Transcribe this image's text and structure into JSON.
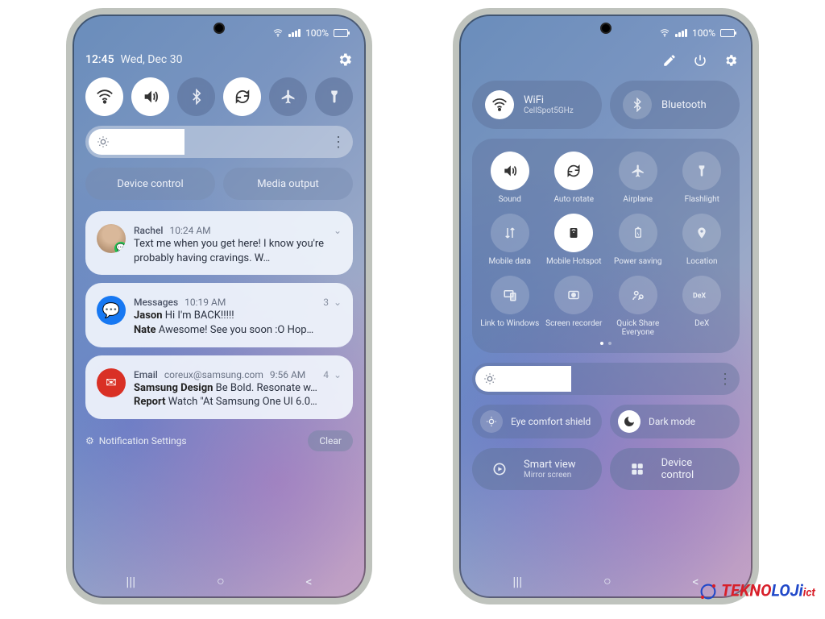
{
  "status": {
    "battery_pct": "100%"
  },
  "panelA": {
    "time": "12:45",
    "date": "Wed, Dec 30",
    "qs": {
      "wifi": "on",
      "sound": "on",
      "bluetooth": "off",
      "rotate": "on",
      "airplane": "off",
      "flashlight": "off"
    },
    "brightness_pct": 40,
    "device_control": "Device control",
    "media_output": "Media output",
    "notifications": [
      {
        "app": "Rachel",
        "time": "10:24 AM",
        "count": "",
        "avatar_color": "#9d7a5a",
        "badge_color": "#1fbf4f",
        "lines": [
          {
            "sender": "",
            "text": "Text me when you get here! I know you're probably having cravings. W…"
          }
        ]
      },
      {
        "app": "Messages",
        "time": "10:19 AM",
        "count": "3",
        "avatar_color": "#1778f2",
        "badge_color": "",
        "lines": [
          {
            "sender": "Jason",
            "text": "Hi I'm BACK!!!!!"
          },
          {
            "sender": "Nate",
            "text": "Awesome! See you soon :O Hop…"
          }
        ]
      },
      {
        "app": "Email",
        "sub": "coreux@samsung.com",
        "time": "9:56 AM",
        "count": "4",
        "avatar_color": "#d93025",
        "badge_color": "",
        "lines": [
          {
            "sender": "Samsung Design",
            "text": "Be Bold. Resonate w…"
          },
          {
            "sender": "Report",
            "text": "Watch \"At Samsung One UI 6.0…"
          }
        ]
      }
    ],
    "settings_label": "Notification Settings",
    "clear_label": "Clear"
  },
  "panelB": {
    "wide": {
      "wifi": {
        "title": "WiFi",
        "sub": "CellSpot5GHz",
        "on": true
      },
      "bt": {
        "title": "Bluetooth",
        "sub": "",
        "on": false
      }
    },
    "grid": [
      {
        "key": "sound",
        "label": "Sound",
        "on": true
      },
      {
        "key": "autorotate",
        "label": "Auto rotate",
        "on": true
      },
      {
        "key": "airplane",
        "label": "Airplane",
        "on": false
      },
      {
        "key": "flashlight",
        "label": "Flashlight",
        "on": false
      },
      {
        "key": "mobiledata",
        "label": "Mobile data",
        "on": false
      },
      {
        "key": "hotspot",
        "label": "Mobile Hotspot",
        "on": true
      },
      {
        "key": "powersave",
        "label": "Power saving",
        "on": false
      },
      {
        "key": "location",
        "label": "Location",
        "on": false
      },
      {
        "key": "linkwin",
        "label": "Link to Windows",
        "on": false
      },
      {
        "key": "screenrec",
        "label": "Screen recorder",
        "on": false
      },
      {
        "key": "quickshare",
        "label": "Quick Share Everyone",
        "on": false
      },
      {
        "key": "dex",
        "label": "DeX",
        "on": false
      }
    ],
    "brightness_pct": 40,
    "eye_label": "Eye comfort shield",
    "dark_label": "Dark mode",
    "smartview": {
      "title": "Smart view",
      "sub": "Mirror screen"
    },
    "devicecontrol_label": "Device control"
  },
  "watermark": {
    "text1": "TEKNO",
    "text2": "LOJi",
    "suffix": "ict"
  }
}
